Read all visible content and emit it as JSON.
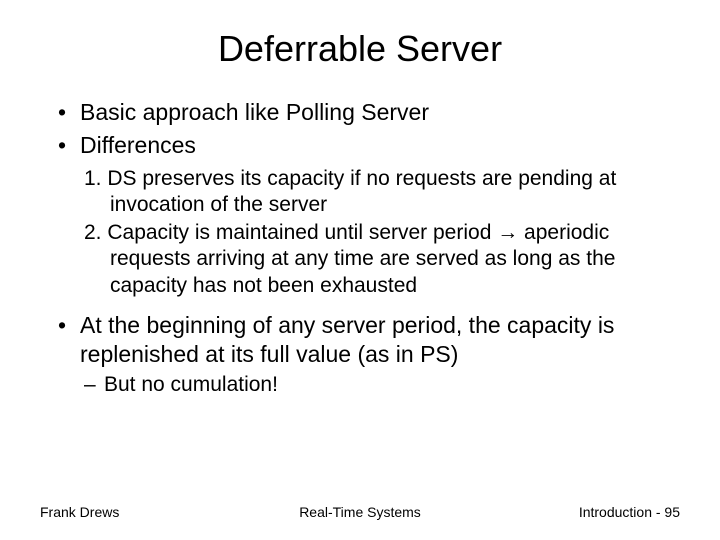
{
  "title": "Deferrable Server",
  "bullets": {
    "b1": "Basic approach like Polling Server",
    "b2": "Differences",
    "n1": "1. DS preserves its capacity if no requests are pending at invocation of the server",
    "n2": "2. Capacity is maintained until server period → aperiodic requests arriving at any time are served as long as the capacity has not been exhausted",
    "b3": "At the beginning of any server period, the capacity is replenished at its full value (as in PS)",
    "d1": "But no cumulation!"
  },
  "footer": {
    "left": "Frank Drews",
    "center": "Real-Time Systems",
    "right": "Introduction - 95"
  }
}
